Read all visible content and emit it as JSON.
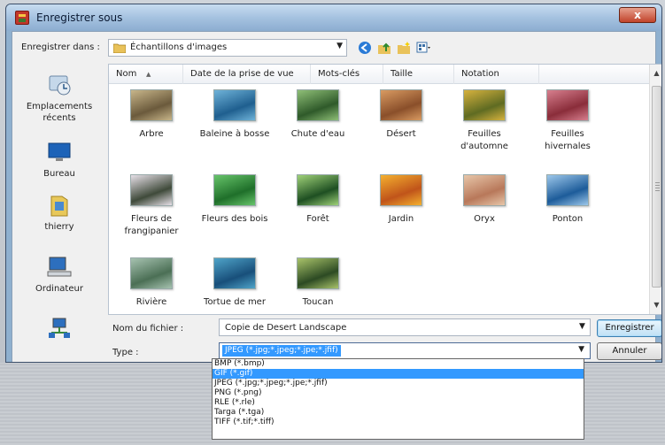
{
  "window": {
    "title": "Enregistrer sous",
    "close_label": "x"
  },
  "toolbar": {
    "save_in_label": "Enregistrer dans :",
    "save_in_value": "Échantillons d'images"
  },
  "places": [
    {
      "label": "Emplacements récents",
      "icon": "recent-places-icon"
    },
    {
      "label": "Bureau",
      "icon": "desktop-icon"
    },
    {
      "label": "thierry",
      "icon": "user-folder-icon"
    },
    {
      "label": "Ordinateur",
      "icon": "computer-icon"
    },
    {
      "label": "",
      "icon": "network-icon"
    }
  ],
  "columns": [
    "Nom",
    "Date de la prise de vue",
    "Mots-clés",
    "Taille",
    "Notation"
  ],
  "files": [
    {
      "name": "Arbre",
      "c1": "#6b5a3c",
      "c2": "#c8b68a"
    },
    {
      "name": "Baleine à bosse",
      "c1": "#1f5f8f",
      "c2": "#6fb3d9"
    },
    {
      "name": "Chute d'eau",
      "c1": "#2f5a2a",
      "c2": "#8fbf77"
    },
    {
      "name": "Désert",
      "c1": "#8a4f2a",
      "c2": "#d99b62"
    },
    {
      "name": "Feuilles d'automne",
      "c1": "#5f6b22",
      "c2": "#d6b23e"
    },
    {
      "name": "Feuilles hivernales",
      "c1": "#8a2d3a",
      "c2": "#d77f8e"
    },
    {
      "name": "Fleurs de frangipanier",
      "c1": "#3f4a3a",
      "c2": "#e7e0e8"
    },
    {
      "name": "Fleurs des bois",
      "c1": "#1f6f2a",
      "c2": "#67c46a"
    },
    {
      "name": "Forêt",
      "c1": "#1e4f22",
      "c2": "#9fd178"
    },
    {
      "name": "Jardin",
      "c1": "#c0541a",
      "c2": "#f4b02f"
    },
    {
      "name": "Oryx",
      "c1": "#b8785a",
      "c2": "#e7c6a9"
    },
    {
      "name": "Ponton",
      "c1": "#1d5c9a",
      "c2": "#9cc7ea"
    },
    {
      "name": "Rivière",
      "c1": "#4b6f55",
      "c2": "#a6c2b0"
    },
    {
      "name": "Tortue de mer",
      "c1": "#184f7a",
      "c2": "#4fa4c9"
    },
    {
      "name": "Toucan",
      "c1": "#2c4a23",
      "c2": "#a9c36a"
    }
  ],
  "form": {
    "filename_label": "Nom du fichier :",
    "filename_value": "Copie de Desert Landscape",
    "type_label": "Type :",
    "type_value": "JPEG (*.jpg;*.jpeg;*.jpe;*.jfif)",
    "save_button": "Enregistrer",
    "cancel_button": "Annuler"
  },
  "dropdown_options": [
    {
      "label": "BMP (*.bmp)",
      "selected": false
    },
    {
      "label": "GIF (*.gif)",
      "selected": true
    },
    {
      "label": "JPEG (*.jpg;*.jpeg;*.jpe;*.jfif)",
      "selected": false
    },
    {
      "label": "PNG (*.png)",
      "selected": false
    },
    {
      "label": "RLE (*.rle)",
      "selected": false
    },
    {
      "label": "Targa (*.tga)",
      "selected": false
    },
    {
      "label": "TIFF (*.tif;*.tiff)",
      "selected": false
    }
  ],
  "colors": {
    "accent": "#3399ff",
    "titlebar": "#a5c2e0",
    "close": "#c1432a"
  }
}
